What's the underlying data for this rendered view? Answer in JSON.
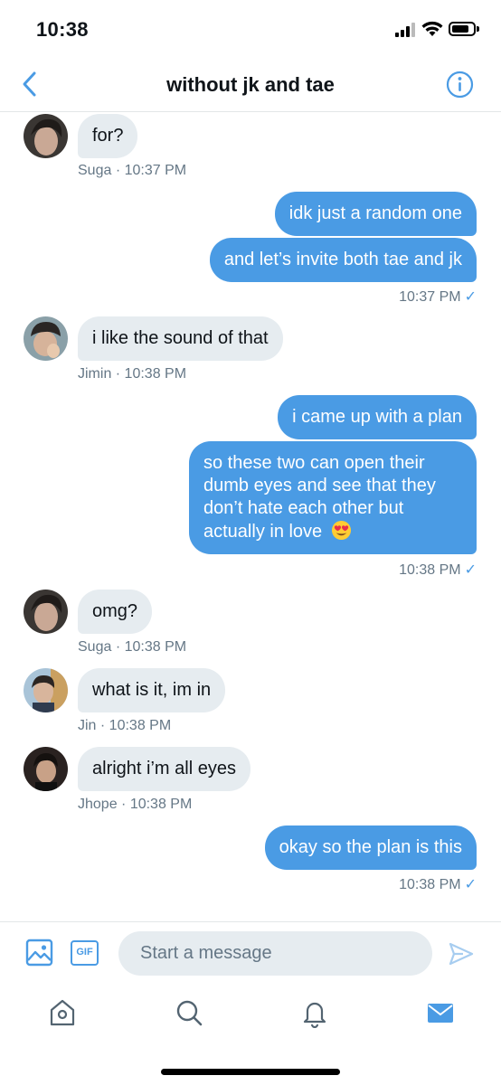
{
  "status_bar": {
    "time": "10:38",
    "battery_level": 0.8
  },
  "header": {
    "title": "without jk and tae",
    "back_icon": "chevron-left-icon",
    "info_icon": "info-icon"
  },
  "colors": {
    "accent": "#4a9be4",
    "bubble_in": "#e6ecf0",
    "muted_text": "#657786"
  },
  "messages": [
    {
      "direction": "in",
      "sender": "Suga",
      "text": "for?",
      "meta": "Suga · 10:37 PM"
    },
    {
      "direction": "out",
      "text": "idk just a random one"
    },
    {
      "direction": "out",
      "text": "and let’s invite both tae and jk",
      "meta": "10:37 PM",
      "read_icon": "checkmark-icon"
    },
    {
      "direction": "in",
      "sender": "Jimin",
      "text": "i like the sound of that",
      "meta": "Jimin · 10:38 PM"
    },
    {
      "direction": "out",
      "text": "i came up with a plan"
    },
    {
      "direction": "out",
      "text": "so these two can open their dumb eyes and see that they don’t hate each other but actually in love",
      "emoji": "heart-eyes-emoji",
      "meta": "10:38 PM",
      "read_icon": "checkmark-icon"
    },
    {
      "direction": "in",
      "sender": "Suga",
      "text": "omg?",
      "meta": "Suga · 10:38 PM"
    },
    {
      "direction": "in",
      "sender": "Jin",
      "text": "what is it, im in",
      "meta": "Jin · 10:38 PM"
    },
    {
      "direction": "in",
      "sender": "Jhope",
      "text": "alright i’m all eyes",
      "meta": "Jhope · 10:38 PM"
    },
    {
      "direction": "out",
      "text": "okay so the plan is this",
      "meta": "10:38 PM",
      "read_icon": "checkmark-icon"
    }
  ],
  "composer": {
    "placeholder": "Start a message",
    "gif_label": "GIF",
    "media_icon": "image-icon",
    "send_icon": "send-icon"
  },
  "tab_bar": {
    "tabs": [
      "home-icon",
      "search-icon",
      "notifications-icon",
      "messages-icon"
    ],
    "active": "messages-icon"
  }
}
